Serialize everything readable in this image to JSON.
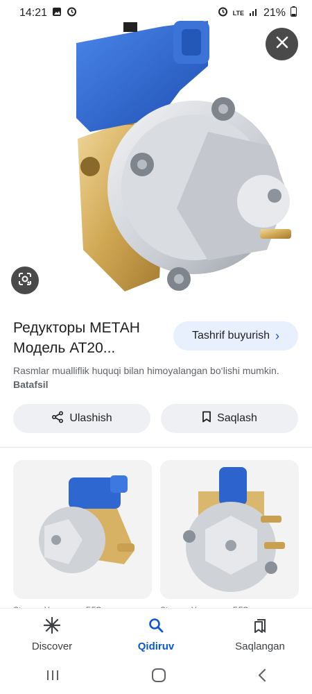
{
  "status_bar": {
    "time": "14:21",
    "network": "LTE",
    "battery": "21%"
  },
  "icons": {
    "close": "close-icon",
    "lens": "google-lens-icon",
    "share": "share-icon",
    "save": "bookmark-icon"
  },
  "result": {
    "title": "Редукторы МЕТАН Модель АТ20...",
    "visit_label": "Tashrif buyurish",
    "copyright_text": "Rasmlar mualliflik huquqi bilan himoyalangan bo‘lishi mumkin.",
    "more_link": "Batafsil",
    "share_label": "Ulashish",
    "save_label": "Saqlash"
  },
  "related": [
    {
      "caption": "Stop up Установка БГО..."
    },
    {
      "caption": "Stop up Установка БГО..."
    }
  ],
  "bottom_nav": [
    {
      "label": "Discover",
      "active": false
    },
    {
      "label": "Qidiruv",
      "active": true
    },
    {
      "label": "Saqlangan",
      "active": false
    }
  ],
  "colors": {
    "accent": "#0b57d0",
    "visit_bg": "#e8f0fe",
    "chip_bg": "#eef0f3",
    "overlay_btn": "#4a4a4a"
  }
}
